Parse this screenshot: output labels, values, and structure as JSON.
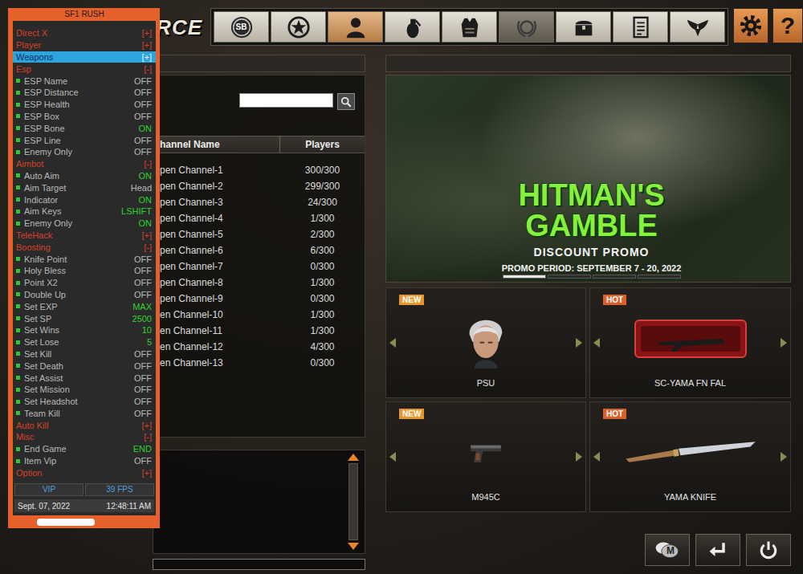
{
  "logo": {
    "text": "FORCE"
  },
  "toolbar": {
    "tabs": [
      {
        "text": "SB",
        "selected": false,
        "disabled": false
      },
      {
        "text": "",
        "selected": false,
        "disabled": false
      },
      {
        "text": "",
        "selected": true,
        "disabled": false
      },
      {
        "text": "",
        "selected": false,
        "disabled": false
      },
      {
        "text": "",
        "selected": false,
        "disabled": false
      },
      {
        "text": "",
        "selected": false,
        "disabled": true
      },
      {
        "text": "",
        "selected": false,
        "disabled": false
      },
      {
        "text": "",
        "selected": false,
        "disabled": false
      },
      {
        "text": "",
        "selected": false,
        "disabled": false
      }
    ],
    "system": [
      {
        "text": ""
      },
      {
        "text": "?"
      }
    ]
  },
  "channels": {
    "search": {
      "value": ""
    },
    "columns": [
      "hannel Name",
      "Players"
    ],
    "rows": [
      {
        "name": "pen Channel-1",
        "players": "300/300"
      },
      {
        "name": "pen Channel-2",
        "players": "299/300"
      },
      {
        "name": "pen Channel-3",
        "players": "24/300"
      },
      {
        "name": "pen Channel-4",
        "players": "1/300"
      },
      {
        "name": "pen Channel-5",
        "players": "2/300"
      },
      {
        "name": "pen Channel-6",
        "players": "6/300"
      },
      {
        "name": "pen Channel-7",
        "players": "0/300"
      },
      {
        "name": "pen Channel-8",
        "players": "1/300"
      },
      {
        "name": "pen Channel-9",
        "players": "0/300"
      },
      {
        "name": "en Channel-10",
        "players": "1/300"
      },
      {
        "name": "en Channel-11",
        "players": "1/300"
      },
      {
        "name": "en Channel-12",
        "players": "4/300"
      },
      {
        "name": "en Channel-13",
        "players": "0/300"
      }
    ]
  },
  "chat": {
    "input": ""
  },
  "banner": {
    "title": "HITMAN'S GAMBLE",
    "subtitle": "DISCOUNT PROMO",
    "period": "PROMO PERIOD: SEPTEMBER 7 - 20, 2022",
    "pages": [
      {
        "selected": true
      },
      {
        "selected": false
      },
      {
        "selected": false
      },
      {
        "selected": false
      }
    ]
  },
  "shopItems": [
    {
      "badge": "NEW",
      "name": "PSU",
      "color": "#e8962a"
    },
    {
      "badge": "HOT",
      "name": "SC-YAMA FN FAL",
      "color": "#d9602a"
    },
    {
      "badge": "NEW",
      "name": "M945C",
      "color": "#e8962a"
    },
    {
      "badge": "HOT",
      "name": "YAMA KNIFE",
      "color": "#d9602a"
    }
  ],
  "bottomButtons": [
    {
      "text": "M"
    },
    {
      "text": ""
    },
    {
      "text": ""
    }
  ],
  "cheatMenu": {
    "title": "SF1 RUSH",
    "rows": [
      {
        "kind": "header",
        "label": "Direct X",
        "toggle": "[+]",
        "selected": false
      },
      {
        "kind": "header",
        "label": "Player",
        "toggle": "[+]",
        "selected": false
      },
      {
        "kind": "header",
        "label": "Weapons",
        "toggle": "[+]",
        "selected": true
      },
      {
        "kind": "header",
        "label": "Esp",
        "toggle": "[-]",
        "selected": false
      },
      {
        "kind": "option",
        "label": "ESP Name",
        "value": "OFF",
        "active": false,
        "selected": false
      },
      {
        "kind": "option",
        "label": "ESP Distance",
        "value": "OFF",
        "active": false,
        "selected": false
      },
      {
        "kind": "option",
        "label": "ESP Health",
        "value": "OFF",
        "active": false,
        "selected": false
      },
      {
        "kind": "option",
        "label": "ESP Box",
        "value": "OFF",
        "active": false,
        "selected": false
      },
      {
        "kind": "option",
        "label": "ESP Bone",
        "value": "ON",
        "active": true,
        "selected": false
      },
      {
        "kind": "option",
        "label": "ESP Line",
        "value": "OFF",
        "active": false,
        "selected": false
      },
      {
        "kind": "option",
        "label": "Enemy Only",
        "value": "OFF",
        "active": false,
        "selected": false
      },
      {
        "kind": "header",
        "label": "Aimbot",
        "toggle": "[-]",
        "selected": false
      },
      {
        "kind": "option",
        "label": "Auto Aim",
        "value": "ON",
        "active": true,
        "selected": false
      },
      {
        "kind": "option",
        "label": "Aim Target",
        "value": "Head",
        "active": false,
        "selected": false
      },
      {
        "kind": "option",
        "label": "Indicator",
        "value": "ON",
        "active": true,
        "selected": false
      },
      {
        "kind": "option",
        "label": "Aim Keys",
        "value": "LSHIFT",
        "active": true,
        "selected": false
      },
      {
        "kind": "option",
        "label": "Enemy Only",
        "value": "ON",
        "active": true,
        "selected": false
      },
      {
        "kind": "header",
        "label": "TeleHack",
        "toggle": "[+]",
        "selected": false
      },
      {
        "kind": "header",
        "label": "Boosting",
        "toggle": "[-]",
        "selected": false
      },
      {
        "kind": "option",
        "label": "Knife Point",
        "value": "OFF",
        "active": false,
        "selected": false
      },
      {
        "kind": "option",
        "label": "Holy Bless",
        "value": "OFF",
        "active": false,
        "selected": false
      },
      {
        "kind": "option",
        "label": "Point X2",
        "value": "OFF",
        "active": false,
        "selected": false
      },
      {
        "kind": "option",
        "label": "Double Up",
        "value": "OFF",
        "active": false,
        "selected": false
      },
      {
        "kind": "option",
        "label": "Set EXP",
        "value": "MAX",
        "active": true,
        "selected": false
      },
      {
        "kind": "option",
        "label": "Set SP",
        "value": "2500",
        "active": true,
        "selected": false
      },
      {
        "kind": "option",
        "label": "Set Wins",
        "value": "10",
        "active": true,
        "selected": false
      },
      {
        "kind": "option",
        "label": "Set Lose",
        "value": "5",
        "active": true,
        "selected": false
      },
      {
        "kind": "option",
        "label": "Set Kill",
        "value": "OFF",
        "active": false,
        "selected": false
      },
      {
        "kind": "option",
        "label": "Set Death",
        "value": "OFF",
        "active": false,
        "selected": false
      },
      {
        "kind": "option",
        "label": "Set Assist",
        "value": "OFF",
        "active": false,
        "selected": false
      },
      {
        "kind": "option",
        "label": "Set Mission",
        "value": "OFF",
        "active": false,
        "selected": false
      },
      {
        "kind": "option",
        "label": "Set Headshot",
        "value": "OFF",
        "active": false,
        "selected": false
      },
      {
        "kind": "option",
        "label": "Team Kill",
        "value": "OFF",
        "active": false,
        "selected": false
      },
      {
        "kind": "header",
        "label": "Auto Kill",
        "toggle": "[+]",
        "selected": false
      },
      {
        "kind": "header",
        "label": "Misc",
        "toggle": "[-]",
        "selected": false
      },
      {
        "kind": "option",
        "label": "End Game",
        "value": "END",
        "active": true,
        "selected": false
      },
      {
        "kind": "option",
        "label": "Item Vip",
        "value": "OFF",
        "active": false,
        "selected": false
      },
      {
        "kind": "header",
        "label": "Option",
        "toggle": "[+]",
        "selected": false
      }
    ],
    "footer": {
      "tier": "VIP",
      "fps": "39 FPS",
      "date": "Sept. 07, 2022",
      "time": "12:48:11 AM"
    }
  }
}
